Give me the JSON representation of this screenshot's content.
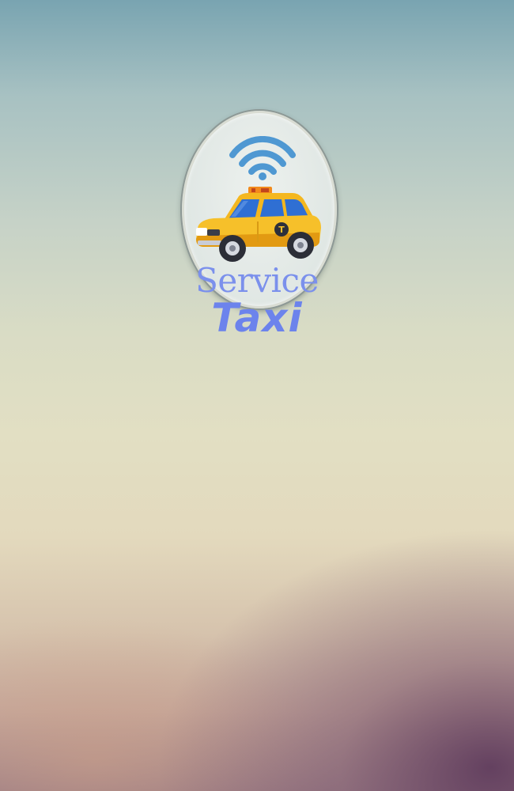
{
  "splash": {
    "brand_line_1": "Service",
    "brand_line_2": "Taxi",
    "taxi_sign_letter": "T",
    "icons": [
      "wifi-signal-icon",
      "taxi-car-icon"
    ],
    "colors": {
      "brand_text": "#7b90ec",
      "taxi_body": "#f6c02a",
      "wifi": "#4a95cf",
      "background_top": "#79a4b1",
      "background_bottom": "#5a3a5a"
    }
  }
}
